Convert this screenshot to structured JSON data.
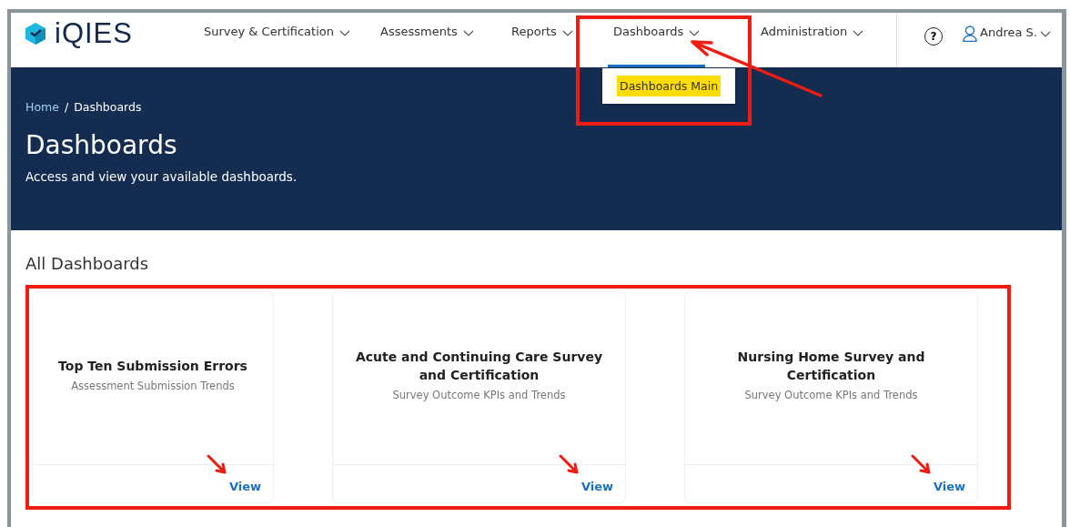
{
  "header": {
    "logo_text": "iQIES",
    "nav": [
      {
        "label": "Survey & Certification",
        "selected": false
      },
      {
        "label": "Assessments",
        "selected": false
      },
      {
        "label": "Reports",
        "selected": false
      },
      {
        "label": "Dashboards",
        "selected": true,
        "expanded": true,
        "menu": [
          {
            "label": "Dashboards Main",
            "highlighted": true
          }
        ]
      },
      {
        "label": "Administration",
        "selected": false
      }
    ],
    "help": "?",
    "user": "Andrea S."
  },
  "hero": {
    "breadcrumb": [
      {
        "label": "Home",
        "link": true
      },
      {
        "label": "Dashboards",
        "link": false
      }
    ],
    "breadcrumb_separator": "/",
    "title": "Dashboards",
    "subtitle": "Access and view your available dashboards."
  },
  "section_title": "All Dashboards",
  "cards": [
    {
      "title": "Top Ten Submission Errors",
      "subtitle": "Assessment Submission Trends",
      "action": "View"
    },
    {
      "title": "Acute and Continuing Care Survey and Certification",
      "subtitle": "Survey Outcome KPIs and Trends",
      "action": "View"
    },
    {
      "title": "Nursing Home Survey and Certification",
      "subtitle": "Survey Outcome KPIs and Trends",
      "action": "View"
    }
  ]
}
